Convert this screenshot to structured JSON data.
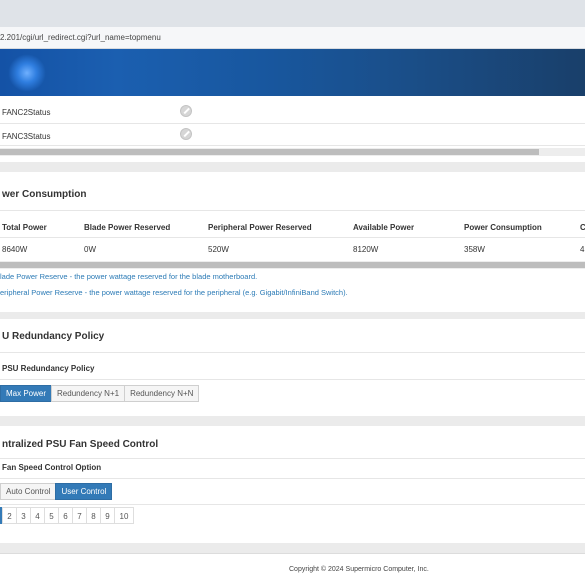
{
  "browser": {
    "url": "2.201/cgi/url_redirect.cgi?url_name=topmenu"
  },
  "fan_status": {
    "rows": [
      {
        "label": "FANC2Status"
      },
      {
        "label": "FANC3Status"
      }
    ]
  },
  "power": {
    "title": "wer Consumption",
    "headers": [
      "Total Power",
      "Blade Power Reserved",
      "Peripheral Power Reserved",
      "Available Power",
      "Power Consumption",
      "C"
    ],
    "values": [
      "8640W",
      "0W",
      "520W",
      "8120W",
      "358W",
      "4"
    ],
    "notes": [
      "lade Power Reserve - the power wattage reserved for the blade motherboard.",
      "eripheral Power Reserve - the power wattage reserved for the peripheral (e.g. Gigabit/InfiniBand Switch)."
    ]
  },
  "psu_policy": {
    "title": "U Redundancy Policy",
    "subhead": "PSU Redundancy Policy",
    "options": [
      "Max Power",
      "Redundency N+1",
      "Redundency N+N"
    ],
    "selected": "Max Power"
  },
  "fan_control": {
    "title": "ntralized PSU Fan Speed Control",
    "subhead": "Fan Speed Control Option",
    "options": [
      "Auto Control",
      "User Control"
    ],
    "selected": "User Control",
    "pages": [
      "",
      "2",
      "3",
      "4",
      "5",
      "6",
      "7",
      "8",
      "9",
      "10"
    ],
    "current_page_index": 0
  },
  "footer": {
    "copyright": "Copyright © 2024 Supermicro Computer, Inc."
  }
}
